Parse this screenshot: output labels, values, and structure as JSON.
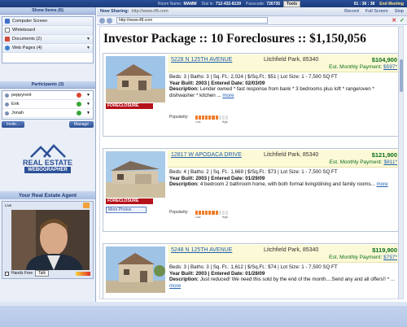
{
  "topbar": {
    "room_name_label": "Room Name:",
    "room_name": "MAMM",
    "dial_in_label": "Dial in:",
    "dial_in": "712-432-8139",
    "passcode_label": "Passcode:",
    "passcode": "726735",
    "tools": "Tools",
    "clock": "01 : 36 : 38",
    "end_meeting": "End Meeting"
  },
  "show_items": {
    "header": "Show Items (6)",
    "items": [
      {
        "label": "Computer Screen",
        "color": "#3b6fc9"
      },
      {
        "label": "Whiteboard",
        "color": "#ffffff"
      },
      {
        "label": "Documents (2)",
        "color": "#d04a3a"
      },
      {
        "label": "Web Pages (4)",
        "color": "#3a7dd0"
      }
    ]
  },
  "participants": {
    "header": "Participants (3)",
    "items": [
      {
        "name": "peppyrent",
        "color": "#d9462f"
      },
      {
        "name": "Erik",
        "color": "#3aa53a"
      },
      {
        "name": "Jonah",
        "color": "#3aa53a"
      }
    ],
    "invite": "Invite...",
    "manage": "Manage"
  },
  "logo": {
    "top": "REAL ESTATE",
    "bottom": "WEBOGRAPHER"
  },
  "agent": {
    "header": "Your Real Estate Agent",
    "live": "Live",
    "hands_free": "Hands Free",
    "talk": "Talk"
  },
  "main": {
    "now_sharing_label": "Now Sharing:",
    "now_sharing_url": "http://www.rf8.com",
    "record": "Record",
    "full_screen": "Full Screen",
    "stop": "Stop",
    "url_value": "http://www.rf8.com"
  },
  "page": {
    "heading": "Investor Package :: 10 Foreclosures :: $1,150,056",
    "popularity": "Popularity:",
    "low": "Low",
    "high": "High",
    "foreclosure": "FORECLOSURE",
    "more_photos": "More Photos"
  },
  "listings": [
    {
      "address": "5228 N 125TH AVENUE",
      "city": "Litchfield Park, 85340",
      "price": "$104,900",
      "est_label": "Est. Monthly Payment:",
      "est": "$597*",
      "line1": "Beds: 3 | Baths: 3 | Sq. Ft.: 2,024 | $/Sq.Ft.: $51 | Lot Size: 1 - 7,500 SQ FT",
      "line2": "Year Built: 2003 | Entered Date: 02/03/09",
      "desc_label": "Description:",
      "desc": "Lender owned * fast response from bank * 3 bedrooms plus loft * range/oven * dishwasher * kitchen ...",
      "more": "more",
      "popularity": 0.7
    },
    {
      "address": "12817 W APODACA DRIVE",
      "city": "Litchfield Park, 85340",
      "price": "$121,900",
      "est_label": "Est. Monthly Payment:",
      "est": "$811*",
      "line1": "Beds: 4 | Baths: 2 | Sq. Ft.: 1,669 | $/Sq.Ft.: $73 | Lot Size: 1 - 7,500 SQ FT",
      "line2": "Year Built: 2003 | Entered Date: 01/29/09",
      "desc_label": "Description:",
      "desc": "4 bedroom 2 bathroom home, with both formal living/dining and family rooms...",
      "more": "more",
      "popularity": 0.7
    },
    {
      "address": "5248 N 125TH AVENUE",
      "city": "Litchfield Park, 85340",
      "price": "$119,900",
      "est_label": "Est. Monthly Payment:",
      "est": "$797*",
      "line1": "Beds: 3 | Baths: 3 | Sq. Ft.: 1,612 | $/Sq.Ft.: $74 | Lot Size: 1 - 7,500 SQ FT",
      "line2": "Year Built: 2003 | Entered Date: 01/28/09",
      "desc_label": "Description:",
      "desc": "Just reduced! We need this sold by the end of the month....Send any and all offers!! * ...",
      "more": "more",
      "popularity": 0.7
    }
  ]
}
